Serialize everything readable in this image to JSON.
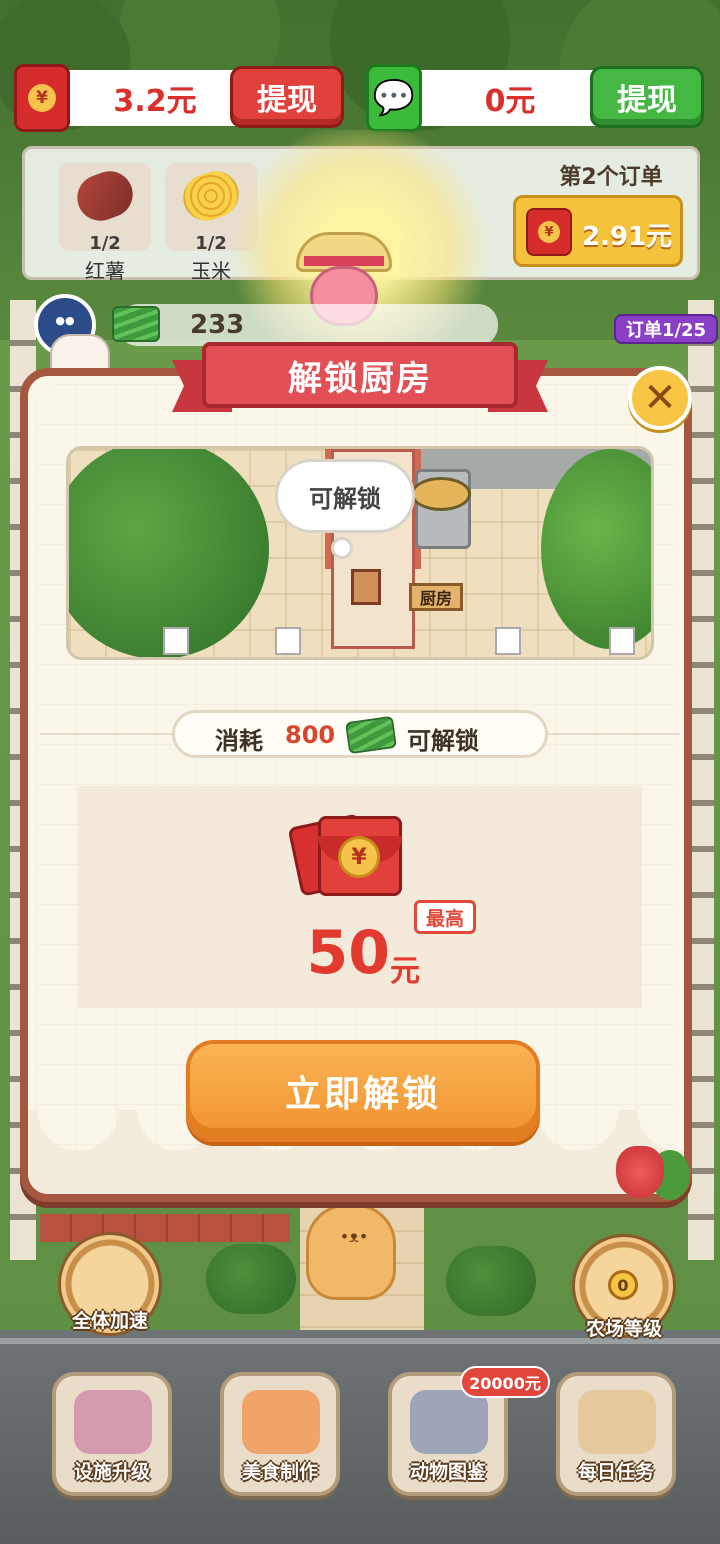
{
  "currency": {
    "redpacket_balance": "3.2元",
    "wechat_balance": "0元",
    "withdraw_label": "提现"
  },
  "order": {
    "title": "第2个订单",
    "reward": "2.91元",
    "items": [
      {
        "name": "红薯",
        "count": "1/2",
        "icon": "sweet-potato-icon"
      },
      {
        "name": "玉米",
        "count": "1/2",
        "icon": "corn-icon"
      }
    ]
  },
  "cash": {
    "value": "233"
  },
  "order_progress": "订单1/25",
  "modal": {
    "title": "解锁厨房",
    "close_glyph": "✕",
    "preview": {
      "bubble": "可解锁",
      "sign": "厨房"
    },
    "cost": {
      "label": "消耗",
      "amount": "800",
      "suffix": "可解锁"
    },
    "reward": {
      "tag": "最高",
      "value": "50",
      "unit": "元",
      "coin_glyph": "¥"
    },
    "unlock_button": "立即解锁"
  },
  "side_buttons": {
    "speed": "全体加速",
    "farm_level": "农场等级",
    "farm_level_value": "0"
  },
  "bottom_nav": [
    {
      "label": "设施升级",
      "icon": "facility-upgrade-icon"
    },
    {
      "label": "美食制作",
      "icon": "cooking-icon"
    },
    {
      "label": "动物图鉴",
      "icon": "animal-collection-icon"
    },
    {
      "label": "每日任务",
      "icon": "daily-task-icon"
    }
  ],
  "bottom_badge": "20000元",
  "colors": {
    "accent_red": "#e2403a",
    "accent_green": "#45b844",
    "button_orange": "#f0922f",
    "modal_border": "#a6573f"
  }
}
